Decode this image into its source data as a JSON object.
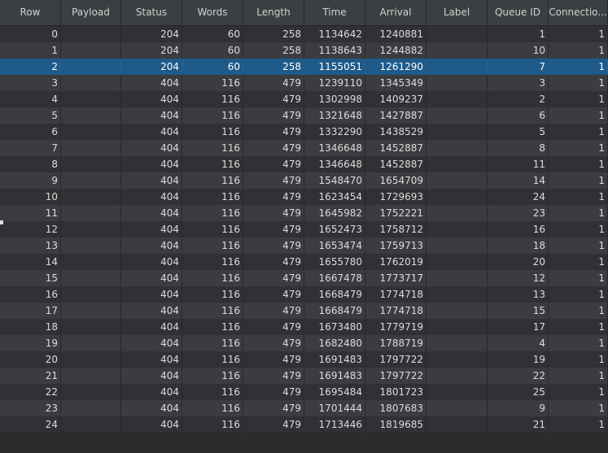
{
  "columns": [
    "Row",
    "Payload",
    "Status",
    "Words",
    "Length",
    "Time",
    "Arrival",
    "Label",
    "Queue ID",
    "Connectio..."
  ],
  "selected_row": 2,
  "rows": [
    [
      "0",
      "",
      "204",
      "60",
      "258",
      "1134642",
      "1240881",
      "",
      "1",
      "1"
    ],
    [
      "1",
      "",
      "204",
      "60",
      "258",
      "1138643",
      "1244882",
      "",
      "10",
      "1"
    ],
    [
      "2",
      "",
      "204",
      "60",
      "258",
      "1155051",
      "1261290",
      "",
      "7",
      "1"
    ],
    [
      "3",
      "",
      "404",
      "116",
      "479",
      "1239110",
      "1345349",
      "",
      "3",
      "1"
    ],
    [
      "4",
      "",
      "404",
      "116",
      "479",
      "1302998",
      "1409237",
      "",
      "2",
      "1"
    ],
    [
      "5",
      "",
      "404",
      "116",
      "479",
      "1321648",
      "1427887",
      "",
      "6",
      "1"
    ],
    [
      "6",
      "",
      "404",
      "116",
      "479",
      "1332290",
      "1438529",
      "",
      "5",
      "1"
    ],
    [
      "7",
      "",
      "404",
      "116",
      "479",
      "1346648",
      "1452887",
      "",
      "8",
      "1"
    ],
    [
      "8",
      "",
      "404",
      "116",
      "479",
      "1346648",
      "1452887",
      "",
      "11",
      "1"
    ],
    [
      "9",
      "",
      "404",
      "116",
      "479",
      "1548470",
      "1654709",
      "",
      "14",
      "1"
    ],
    [
      "10",
      "",
      "404",
      "116",
      "479",
      "1623454",
      "1729693",
      "",
      "24",
      "1"
    ],
    [
      "11",
      "",
      "404",
      "116",
      "479",
      "1645982",
      "1752221",
      "",
      "23",
      "1"
    ],
    [
      "12",
      "",
      "404",
      "116",
      "479",
      "1652473",
      "1758712",
      "",
      "16",
      "1"
    ],
    [
      "13",
      "",
      "404",
      "116",
      "479",
      "1653474",
      "1759713",
      "",
      "18",
      "1"
    ],
    [
      "14",
      "",
      "404",
      "116",
      "479",
      "1655780",
      "1762019",
      "",
      "20",
      "1"
    ],
    [
      "15",
      "",
      "404",
      "116",
      "479",
      "1667478",
      "1773717",
      "",
      "12",
      "1"
    ],
    [
      "16",
      "",
      "404",
      "116",
      "479",
      "1668479",
      "1774718",
      "",
      "13",
      "1"
    ],
    [
      "17",
      "",
      "404",
      "116",
      "479",
      "1668479",
      "1774718",
      "",
      "15",
      "1"
    ],
    [
      "18",
      "",
      "404",
      "116",
      "479",
      "1673480",
      "1779719",
      "",
      "17",
      "1"
    ],
    [
      "19",
      "",
      "404",
      "116",
      "479",
      "1682480",
      "1788719",
      "",
      "4",
      "1"
    ],
    [
      "20",
      "",
      "404",
      "116",
      "479",
      "1691483",
      "1797722",
      "",
      "19",
      "1"
    ],
    [
      "21",
      "",
      "404",
      "116",
      "479",
      "1691483",
      "1797722",
      "",
      "22",
      "1"
    ],
    [
      "22",
      "",
      "404",
      "116",
      "479",
      "1695484",
      "1801723",
      "",
      "25",
      "1"
    ],
    [
      "23",
      "",
      "404",
      "116",
      "479",
      "1701444",
      "1807683",
      "",
      "9",
      "1"
    ],
    [
      "24",
      "",
      "404",
      "116",
      "479",
      "1713446",
      "1819685",
      "",
      "21",
      "1"
    ]
  ]
}
